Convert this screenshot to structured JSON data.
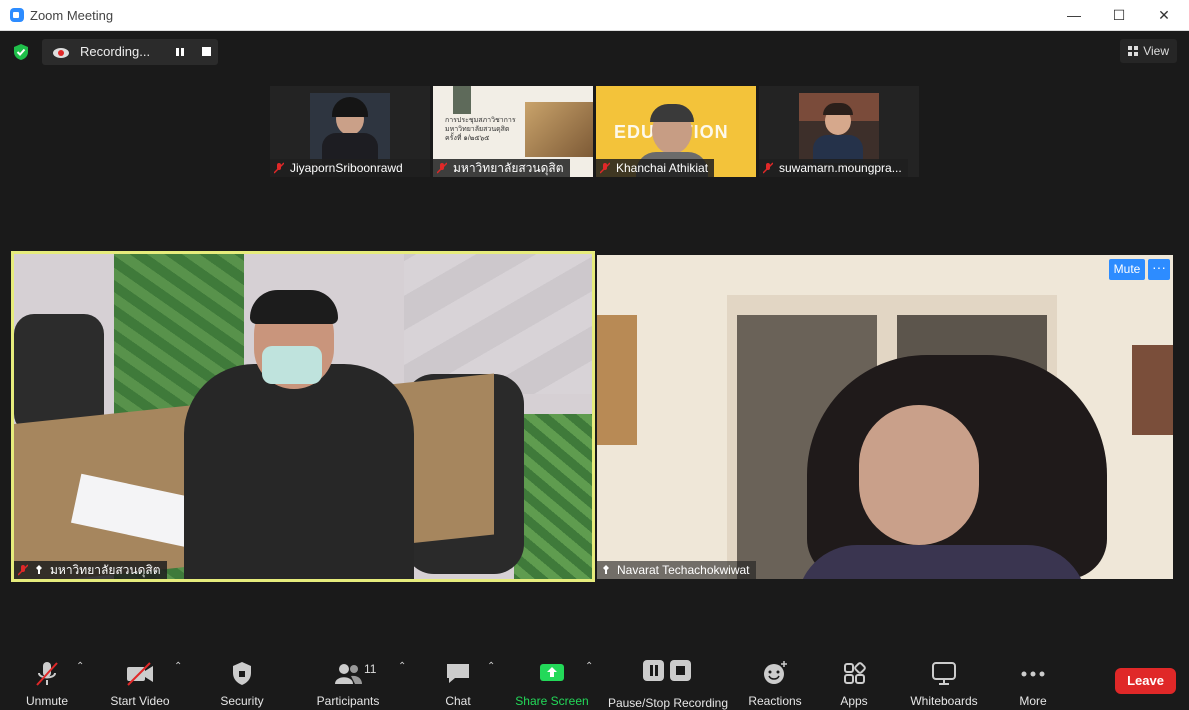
{
  "window": {
    "title": "Zoom Meeting",
    "minimize": "—",
    "maximize": "☐",
    "close": "✕"
  },
  "recording": {
    "label": "Recording..."
  },
  "view_button": {
    "label": "View"
  },
  "thumbnails": [
    {
      "name": "JiyapornSriboonrawd"
    },
    {
      "name": "มหาวิทยาลัยสวนดุสิต",
      "slide_lines": [
        "การประชุมสภาวิชาการ",
        "มหาวิทยาลัยสวนดุสิต",
        "ครั้งที่ ๑/๒๕๖๕"
      ]
    },
    {
      "name": "Khanchai Athikiat",
      "bg_text": "EDUCATION"
    },
    {
      "name": "suwamarn.moungpra..."
    }
  ],
  "main_tiles": [
    {
      "name": "มหาวิทยาลัยสวนดุสิต"
    },
    {
      "name": "Navarat Techachokwiwat"
    }
  ],
  "tile_controls": {
    "mute_label": "Mute",
    "more_label": "···"
  },
  "toolbar": {
    "unmute": "Unmute",
    "start_video": "Start Video",
    "security": "Security",
    "participants": "Participants",
    "participants_count": "11",
    "chat": "Chat",
    "share_screen": "Share Screen",
    "pause_stop_recording": "Pause/Stop Recording",
    "reactions": "Reactions",
    "apps": "Apps",
    "whiteboards": "Whiteboards",
    "more": "More",
    "leave": "Leave"
  },
  "colors": {
    "accent_blue": "#2d8cff",
    "share_green": "#23d959",
    "leave_red": "#e02828",
    "active_speaker_border": "#e6ec7c"
  }
}
